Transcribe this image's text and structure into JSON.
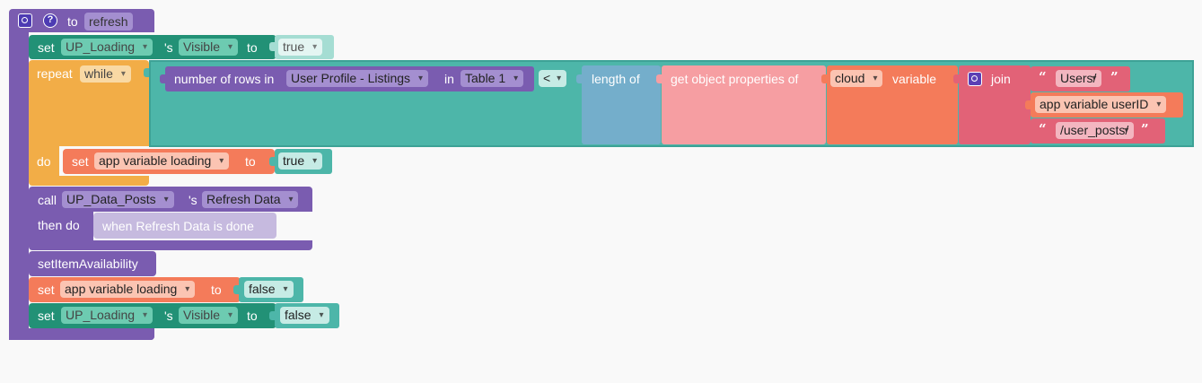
{
  "colors": {
    "procedure": "#7a5cb0",
    "component": "#229176",
    "logic": "#4db6a9",
    "control": "#f2ad47",
    "variable": "#f47b5a",
    "math_blue": "#74aecb",
    "dictionary": "#f69ea2",
    "text_join": "#e26277"
  },
  "procedure": {
    "keyword": "to",
    "name": "refresh",
    "gear_icon": "gear-icon",
    "help_icon": "help-icon",
    "help_glyph": "?"
  },
  "set_visible_true": {
    "set": "set",
    "component": "UP_Loading",
    "possessive": "'s",
    "property": "Visible",
    "to": "to",
    "value": "true"
  },
  "repeat_while": {
    "repeat": "repeat",
    "while": "while",
    "do": "do",
    "rows_label": "number of rows in",
    "rows_source": "User Profile - Listings",
    "in": "in",
    "table": "Table 1",
    "compare_op": "<",
    "length_of": "length of",
    "get_props": "get object properties of",
    "cloud": "cloud",
    "variable": "variable",
    "join": "join",
    "join_items": [
      "Users/",
      "app variable userID",
      "/user_posts/"
    ],
    "open_quote": "“",
    "close_quote": "”"
  },
  "set_loading_true": {
    "set": "set",
    "variable": "app variable loading",
    "to": "to",
    "value": "true"
  },
  "call_refresh": {
    "call": "call",
    "component": "UP_Data_Posts",
    "possessive": "'s",
    "method": "Refresh Data",
    "then_do": "then do",
    "callback": "when Refresh Data is done"
  },
  "set_item_availability": {
    "label": "setItemAvailability"
  },
  "set_loading_false": {
    "set": "set",
    "variable": "app variable loading",
    "to": "to",
    "value": "false"
  },
  "set_visible_false": {
    "set": "set",
    "component": "UP_Loading",
    "possessive": "'s",
    "property": "Visible",
    "to": "to",
    "value": "false"
  }
}
